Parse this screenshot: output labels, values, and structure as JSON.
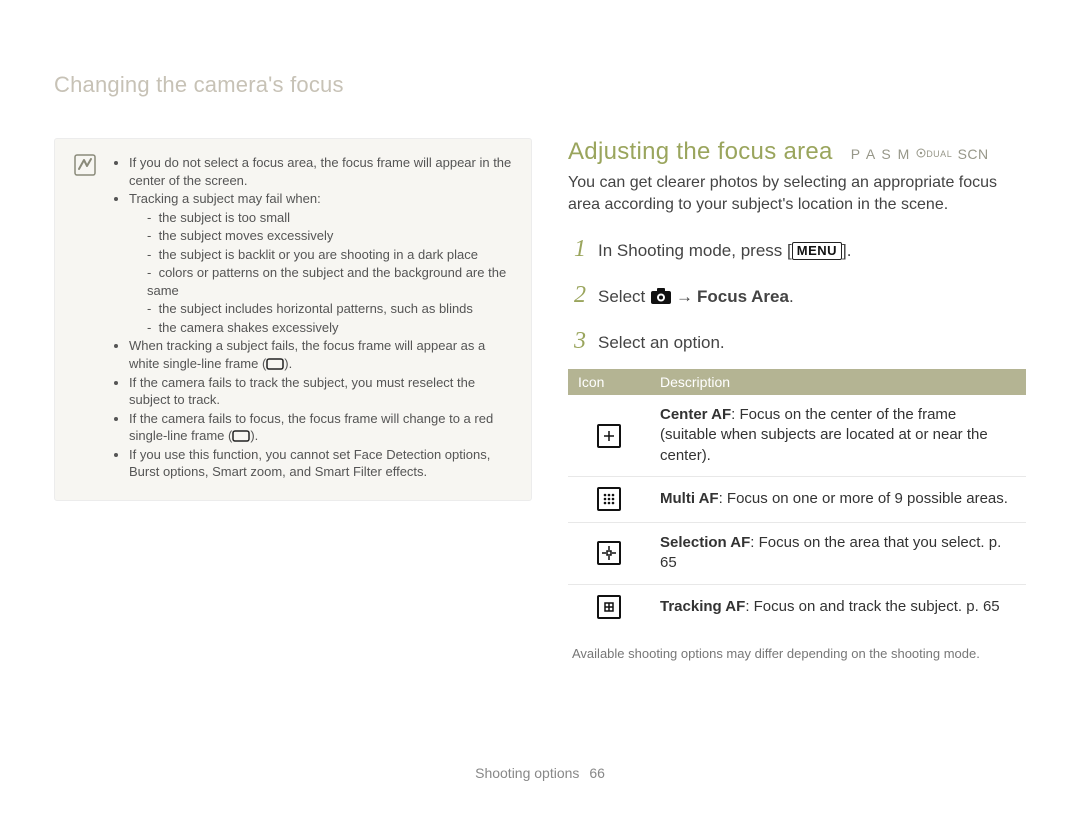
{
  "section_title": "Changing the camera's focus",
  "note": {
    "items": [
      "If you do not select a focus area, the focus frame will appear in the center of the screen.",
      "Tracking a subject may fail when:"
    ],
    "fail_reasons": [
      "the subject is too small",
      "the subject moves excessively",
      "the subject is backlit or you are shooting in a dark place",
      "colors or patterns on the subject and the background are the same",
      "the subject includes horizontal patterns, such as blinds",
      "the camera shakes excessively"
    ],
    "items2_prefix": "When tracking a subject fails, the focus frame will appear as a white single-line frame (",
    "items2_suffix": ").",
    "items3": "If the camera fails to track the subject, you must reselect the subject to track.",
    "items4_prefix": "If the camera fails to focus, the focus frame will change to a red single-line frame (",
    "items4_suffix": ").",
    "items5": "If you use this function, you cannot set Face Detection options, Burst options, Smart zoom, and Smart Filter effects."
  },
  "right": {
    "heading": "Adjusting the focus area",
    "modes": {
      "p": "P",
      "a": "A",
      "s": "S",
      "m": "M",
      "dual": "DUAL",
      "scn": "SCN"
    },
    "intro": "You can get clearer photos by selecting an appropriate focus area according to your subject's location in the scene.",
    "steps": {
      "s1_pre": "In Shooting mode, press [",
      "s1_menu": "MENU",
      "s1_post": "].",
      "s2_pre": "Select ",
      "s2_arrow": "→",
      "s2_focus_area": "Focus Area",
      "s2_post": ".",
      "s3": "Select an option."
    },
    "table": {
      "head_icon": "Icon",
      "head_desc": "Description",
      "rows": [
        {
          "icon": "center-af-icon",
          "bold": "Center AF",
          "text": ": Focus on the center of the frame (suitable when subjects are located at or near the center)."
        },
        {
          "icon": "multi-af-icon",
          "bold": "Multi AF",
          "text": ": Focus on one or more of 9 possible areas."
        },
        {
          "icon": "selection-af-icon",
          "bold": "Selection AF",
          "text": ": Focus on the area that you select. p. 65"
        },
        {
          "icon": "tracking-af-icon",
          "bold": "Tracking AF",
          "text": ": Focus on and track the subject. p. 65"
        }
      ],
      "note": "Available shooting options may differ depending on the shooting mode."
    }
  },
  "footer": {
    "label": "Shooting options",
    "page": "66"
  }
}
